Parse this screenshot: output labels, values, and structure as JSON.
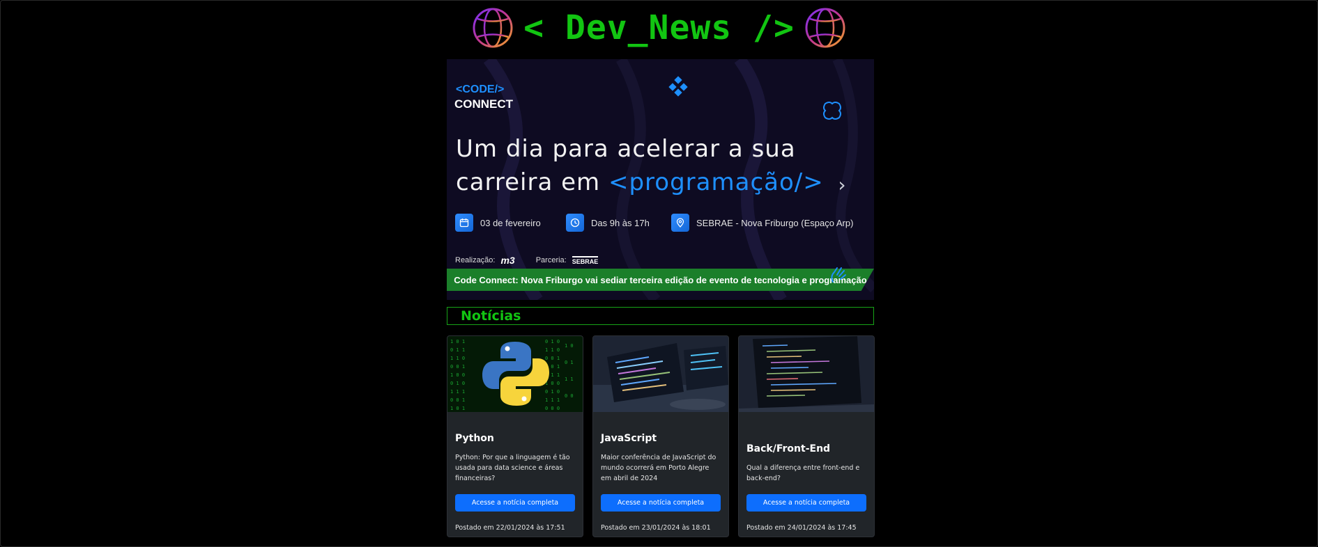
{
  "header": {
    "title": "< Dev_News />",
    "left_icon": "globe-icon",
    "right_icon": "globe-icon"
  },
  "carousel": {
    "logo_code": "<CODE/>",
    "logo_connect": "CONNECT",
    "headline_line1": "Um dia para acelerar a sua",
    "headline_line2_prefix": "carreira em",
    "headline_highlight": "<programação/>",
    "date": "03 de fevereiro",
    "time": "Das 9h às 17h",
    "location": "SEBRAE - Nova Friburgo (Espaço Arp)",
    "realizacao_label": "Realização:",
    "realizacao_logo": "m3",
    "parceria_label": "Parceria:",
    "parceria_logo": "SEBRAE",
    "caption": "Code Connect: Nova Friburgo vai sediar terceira edição de evento de tecnologia e programação",
    "next_icon": "chevron-right-icon",
    "accent_color": "#1e90ff",
    "caption_bg": "#1b7f2a"
  },
  "section": {
    "title": "Notícias"
  },
  "cards": [
    {
      "title": "Python",
      "text": "Python: Por que a linguagem é tão usada para data science e áreas financeiras?",
      "button": "Acesse a notícia completa",
      "date": "Postado em 22/01/2024 às 17:51"
    },
    {
      "title": "JavaScript",
      "text": "Maior conferência de JavaScript do mundo ocorrerá em Porto Alegre em abril de 2024",
      "button": "Acesse a notícia completa",
      "date": "Postado em 23/01/2024 às 18:01"
    },
    {
      "title": "Back/Front-End",
      "text": "Qual a diferença entre front-end e back-end?",
      "button": "Acesse a notícia completa",
      "date": "Postado em 24/01/2024 às 17:45"
    }
  ],
  "colors": {
    "brand_green": "#12c512",
    "button_blue": "#0d6efd",
    "card_bg": "#212529"
  }
}
